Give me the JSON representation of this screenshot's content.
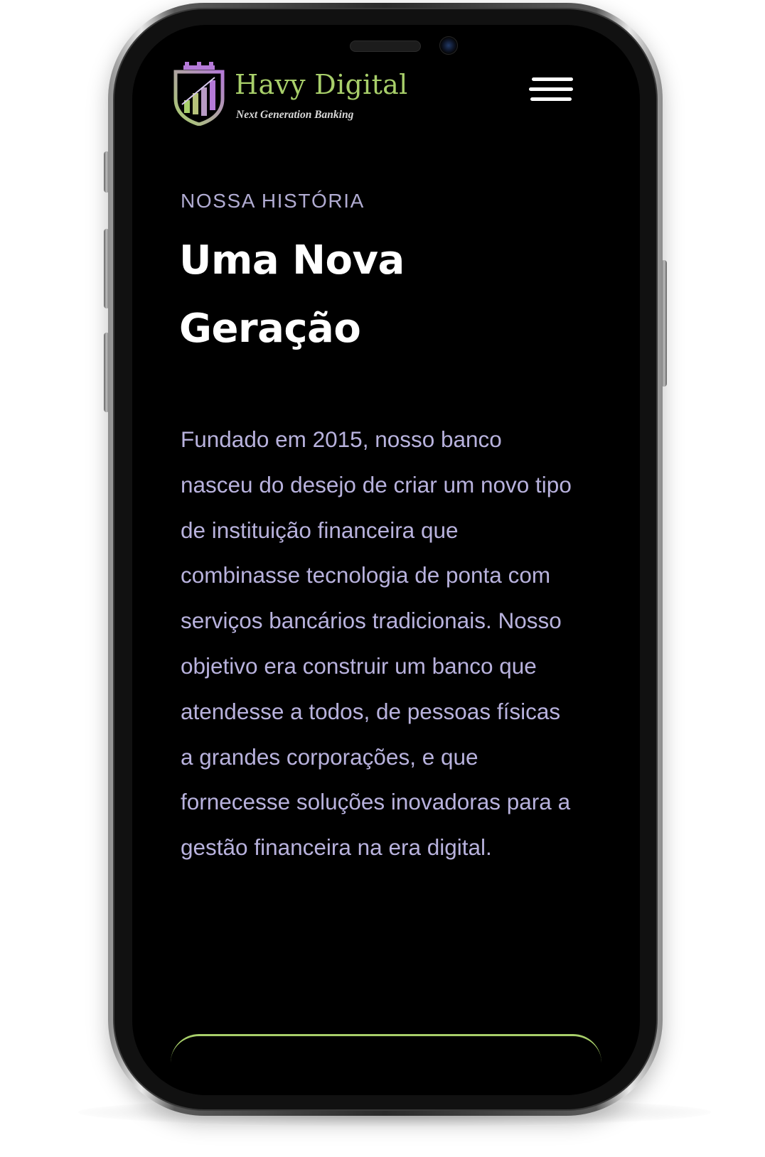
{
  "header": {
    "brand_name": "Havy Digital",
    "brand_tagline": "Next Generation Banking",
    "logo_icon": "bank-shield-bar-chart-icon",
    "menu_icon": "hamburger-menu-icon"
  },
  "section": {
    "eyebrow": "NOSSA HISTÓRIA",
    "title": "Uma Nova Geração",
    "body": "Fundado em 2015, nosso banco nasceu do desejo de criar um novo tipo de instituição financeira que combinasse tecnologia de ponta com serviços bancários tradicionais. Nosso objetivo era construir um banco que atendesse a todos, de pessoas físicas a grandes corporações, e que fornecesse soluções inovadoras para a gestão financeira na era digital."
  },
  "colors": {
    "background": "#000000",
    "brand_green": "#a8cf6a",
    "brand_purple": "#b57ad8",
    "text_lavender": "#b8b2dd",
    "heading": "#ffffff"
  }
}
